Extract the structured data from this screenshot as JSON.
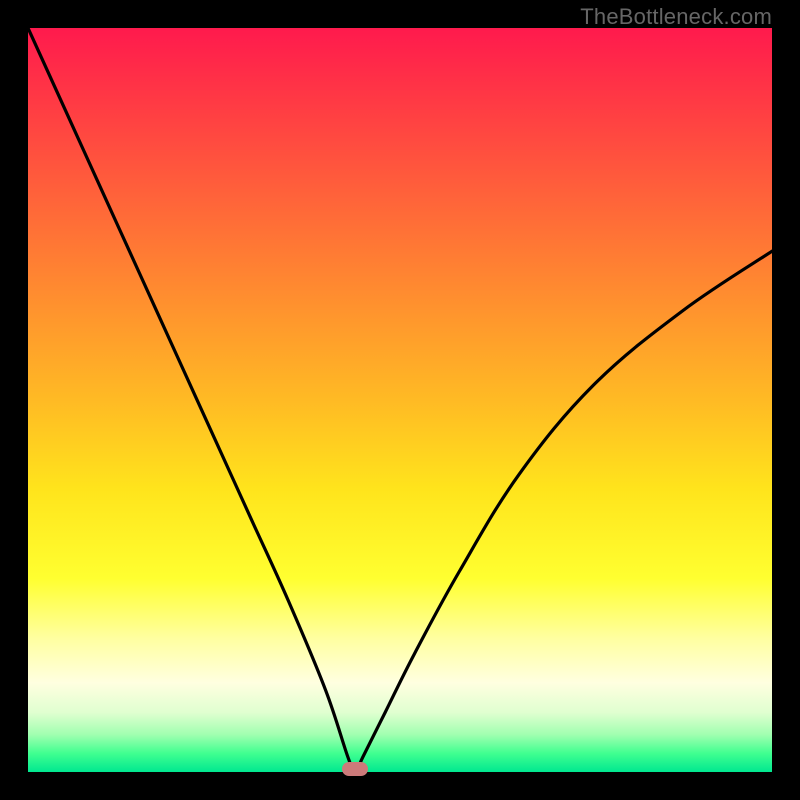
{
  "watermark": {
    "text": "TheBottleneck.com"
  },
  "colors": {
    "frame": "#000000",
    "curve": "#000000",
    "marker": "#cc7a7a",
    "gradient_stops": [
      "#ff1a4d",
      "#ff3a44",
      "#ff5a3c",
      "#ff7a34",
      "#ff9a2c",
      "#ffba24",
      "#ffe41c",
      "#ffff30",
      "#ffffa0",
      "#ffffe0",
      "#e0ffd0",
      "#a0ffb0",
      "#40ff90",
      "#00e890"
    ]
  },
  "chart_data": {
    "type": "line",
    "title": "",
    "xlabel": "",
    "ylabel": "",
    "xlim": [
      0,
      100
    ],
    "ylim": [
      0,
      100
    ],
    "note": "V-shaped bottleneck curve; minimum (0% bottleneck) near x≈44; y rises toward 100% at x=0 and ~70% at x=100. Values estimated from unlabeled axes.",
    "series": [
      {
        "name": "bottleneck-curve",
        "x": [
          0,
          5,
          10,
          15,
          20,
          25,
          30,
          35,
          40,
          43,
          44,
          45,
          48,
          52,
          58,
          66,
          76,
          88,
          100
        ],
        "values": [
          100,
          89,
          78,
          67,
          56,
          45,
          34,
          23,
          11,
          2,
          0,
          2,
          8,
          16,
          27,
          40,
          52,
          62,
          70
        ]
      }
    ],
    "marker": {
      "x": 44,
      "y": 0,
      "label": ""
    }
  }
}
